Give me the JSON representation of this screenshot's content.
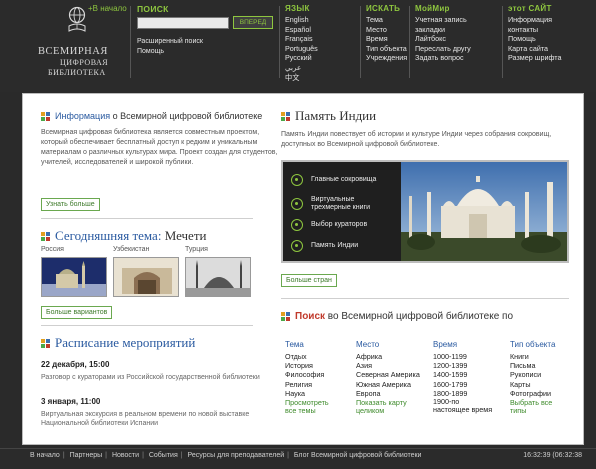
{
  "header": {
    "home_link": "+В начало",
    "logo_lines": [
      "ВСЕМИРНАЯ",
      "ЦИФРОВАЯ",
      "БИБЛИОТЕКА"
    ],
    "search": {
      "title": "ПОИСК",
      "input_value": "",
      "button": "ВПЕРЕД",
      "advanced": "Расширенный поиск",
      "help": "Помощь"
    },
    "columns": [
      {
        "title": "ЯЗЫК",
        "items": [
          "English",
          "Español",
          "Français",
          "Português",
          "Русский",
          "عربي",
          "中文"
        ]
      },
      {
        "title": "ИСКАТЬ",
        "items": [
          "Тема",
          "Место",
          "Время",
          "Тип объекта",
          "Учреждения"
        ]
      },
      {
        "title": "МойМир",
        "items": [
          "Учетная запись",
          "закладки",
          "Лайтбокс",
          "Переслать другу",
          "Задать вопрос"
        ]
      },
      {
        "title": "этот САЙТ",
        "items": [
          "Информация",
          "контакты",
          "Помощь",
          "Карта сайта",
          "Размер шрифта"
        ]
      }
    ]
  },
  "left": {
    "info_title_blue": "Информация",
    "info_title_rest": " о Всемирной цифровой библиотеке",
    "info_text": "Всемирная цифровая библиотека является совместным проектом, который обеспечивает бесплатный доступ к редким и уникальным материалам о различных культурах мира. Проект создан для студентов, учителей, исследователей и широкой публики.",
    "info_button": "Узнать больше",
    "today_blue": "Сегодняшняя тема:",
    "today_dark": " Мечети",
    "thumbs": [
      "Россия",
      "Узбекистан",
      "Турция"
    ],
    "today_button": "Больше вариантов",
    "schedule_title": "Расписание мероприятий",
    "events": [
      {
        "date": "22 декабря, 15:00",
        "text": "Разговор с кураторами из Российской государственной библиотеки"
      },
      {
        "date": "3 января, 11:00",
        "text": "Виртуальная экскурсия в реальном времени по новой выставке Национальной библиотеки Испании"
      }
    ]
  },
  "right": {
    "india_title": "Память Индии",
    "india_text": "Память Индии повествует об истории и культуре Индии через собрания сокровищ, доступных во Всемирной цифровой библиотеке.",
    "india_menu": [
      "Главные сокровища",
      "Виртуальные трехмерные книги",
      "Выбор кураторов",
      "Память Индии"
    ],
    "india_button": "Больше стран",
    "search_title_red": "Поиск",
    "search_title_rest": " во Всемирной цифровой библиотеке по",
    "search_columns": [
      {
        "title": "Тема",
        "items": [
          "Отдых",
          "История",
          "Философия",
          "Религия",
          "Наука"
        ],
        "more": [
          "Просмотреть",
          "все темы"
        ]
      },
      {
        "title": "Место",
        "items": [
          "Африка",
          "Азия",
          "Северная Америка",
          "Южная Америка",
          "Европа"
        ],
        "more": [
          "Показать карту",
          "целиком"
        ]
      },
      {
        "title": "Время",
        "items": [
          "1000-1199",
          "1200-1399",
          "1400-1599",
          "1600-1799",
          "1800-1899",
          "1900-по настоящее время"
        ],
        "more": []
      },
      {
        "title": "Тип объекта",
        "items": [
          "Книги",
          "Письма",
          "Рукописи",
          "Карты",
          "Фотографии"
        ],
        "more": [
          "Выбрать все",
          "типы"
        ]
      }
    ]
  },
  "footer": {
    "links": [
      "В начало",
      "Партнеры",
      "Новости",
      "События",
      "Ресурсы для преподавателей",
      "Блог Всемирной цифровой библиотеки"
    ],
    "time": "16:32:39 (06:32:38"
  },
  "colors": {
    "accent_green": "#8ec63f",
    "link_blue": "#2a5aa0",
    "search_red": "#c0392b"
  }
}
